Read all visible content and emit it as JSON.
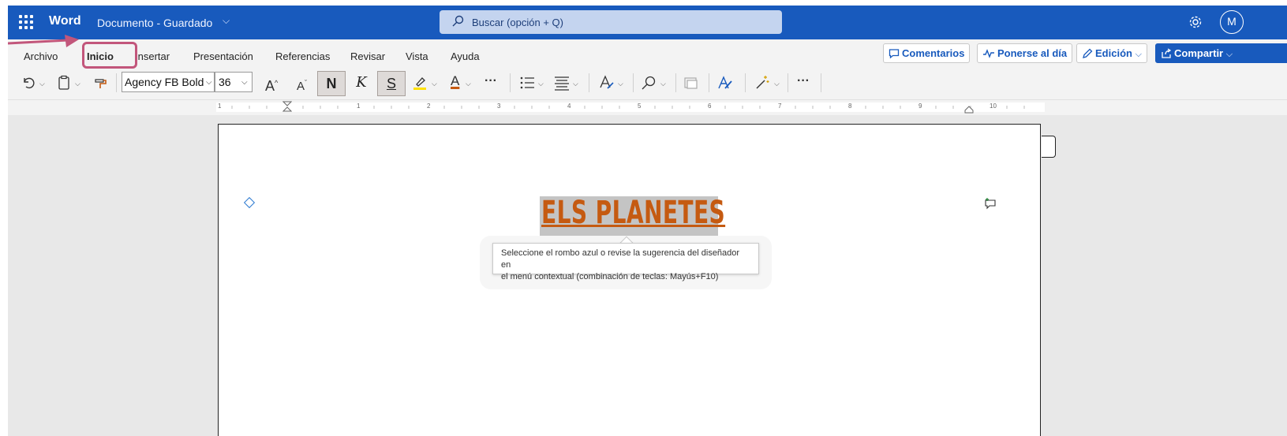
{
  "titlebar": {
    "app_name": "Word",
    "doc_title": "Documento - Guardado",
    "search_placeholder": "Buscar (opción + Q)",
    "avatar_initial": "M"
  },
  "ribbon": {
    "tabs": [
      "Archivo",
      "Inicio",
      "Insertar",
      "Presentación",
      "Referencias",
      "Revisar",
      "Vista",
      "Ayuda"
    ],
    "active_tab": "Inicio",
    "comments_label": "Comentarios",
    "catch_up_label": "Ponerse al día",
    "editing_label": "Edición",
    "share_label": "Compartir"
  },
  "toolbar": {
    "font_name": "Agency FB Bold",
    "font_size": "36",
    "grow_font": "A",
    "shrink_font": "A",
    "bold_label": "N",
    "italic_label": "K",
    "underline_label": "S",
    "font_color_label": "A",
    "more_label": "···"
  },
  "ruler": {
    "labels": [
      "1",
      "1",
      "2",
      "3",
      "4",
      "5",
      "6",
      "7",
      "8",
      "9",
      "10"
    ]
  },
  "document": {
    "heading": "ELS PLANETES",
    "tooltip_line1": "Seleccione el rombo azul o revise la sugerencia del diseñador en",
    "tooltip_line2": "el menú contextual (combinación de teclas: Mayús+F10)"
  },
  "colors": {
    "titlebar": "#185abd",
    "heading": "#c55a11",
    "annotation": "#c2567b",
    "highlight_marker": "#ffe100",
    "font_color_bar": "#c55a11"
  }
}
